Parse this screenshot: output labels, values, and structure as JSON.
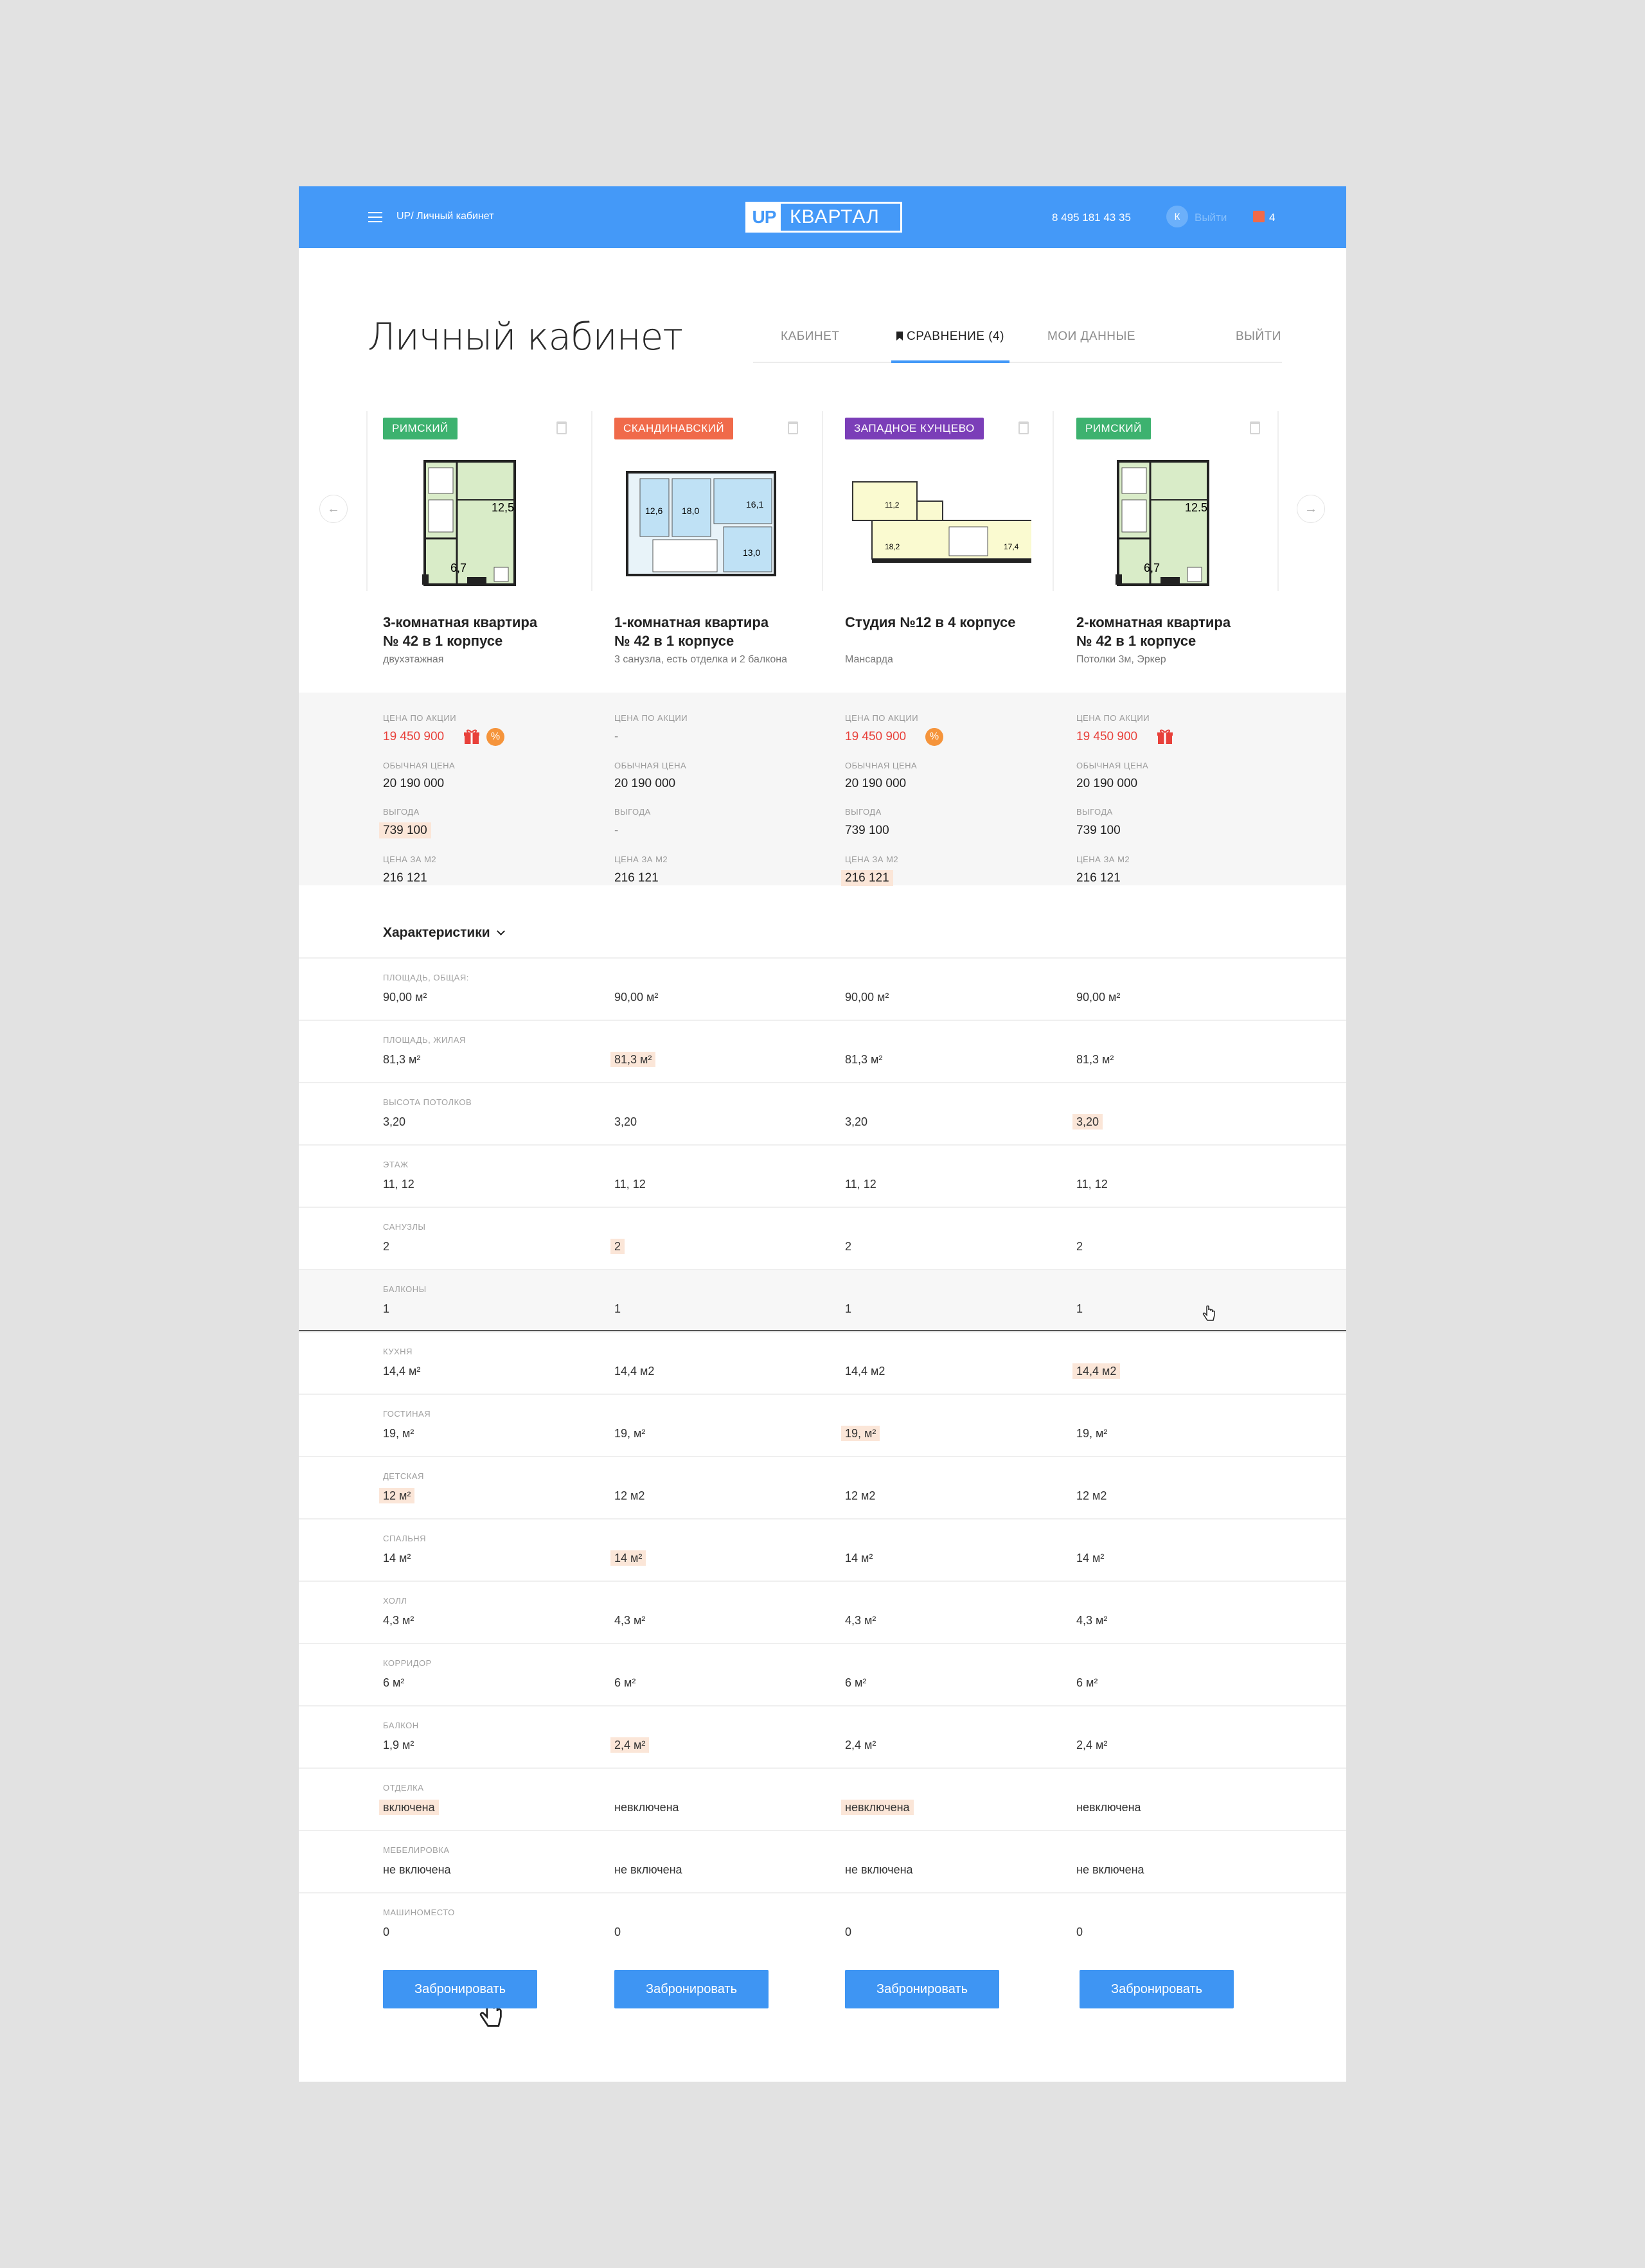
{
  "header": {
    "breadcrumb": "UP/ Личный кабинет",
    "logo_up": "UP",
    "logo_name": "КВАРТАЛ",
    "phone": "8 495 181 43 35",
    "avatar_letter": "К",
    "logout_link": "Выйти",
    "compare_count": "4",
    "bg_color": "#4499f8"
  },
  "page": {
    "title": "Личный кабинет",
    "tabs": [
      "КАБИНЕТ",
      "СРАВНЕНИЕ (4)",
      "МОИ ДАННЫЕ",
      "ВЫЙТИ"
    ],
    "active_tab": "СРАВНЕНИЕ (4)"
  },
  "carousel": {
    "prev_icon": "arrow-left-icon",
    "next_icon": "arrow-right-icon"
  },
  "products": [
    {
      "badge": "РИМСКИЙ",
      "badge_color": "#3db26f",
      "title1": "3-комнатная квартира",
      "title2": "№ 42 в 1 корпусе",
      "subtitle": "двухэтажная",
      "promo_price": "19 450 900",
      "regular_price": "20 190 000",
      "benefit": "739 100",
      "price_m2": "216 121",
      "icons": [
        "gift-icon",
        "sale-icon"
      ]
    },
    {
      "badge": "СКАНДИНАВСКИЙ",
      "badge_color": "#f06a4a",
      "title1": "1-комнатная квартира",
      "title2": "№ 42 в 1 корпусе",
      "subtitle": "3 санузла, есть отделка и 2 балкона",
      "promo_price": "-",
      "regular_price": "20 190 000",
      "benefit": "-",
      "price_m2": "216 121",
      "icons": []
    },
    {
      "badge": "ЗАПАДНОЕ КУНЦЕВО",
      "badge_color": "#7b3eb8",
      "title1": "Студия №12 в 4 корпусе",
      "title2": "",
      "subtitle": "Мансарда",
      "promo_price": "19 450 900",
      "regular_price": "20 190 000",
      "benefit": "739 100",
      "price_m2": "216 121",
      "icons": [
        "sale-icon"
      ]
    },
    {
      "badge": "РИМСКИЙ",
      "badge_color": "#3db26f",
      "title1": "2-комнатная квартира",
      "title2": "№ 42 в 1 корпусе",
      "subtitle": "Потолки 3м, Эркер",
      "promo_price": "19 450 900",
      "regular_price": "20 190 000",
      "benefit": "739 100",
      "price_m2": "216 121",
      "icons": [
        "gift-icon"
      ]
    }
  ],
  "price_labels": {
    "promo": "ЦЕНА ПО АКЦИИ",
    "regular": "ОБЫЧНАЯ ЦЕНА",
    "benefit": "ВЫГОДА",
    "per_m2": "ЦЕНА ЗА М2"
  },
  "characteristics": {
    "title": "Характеристики",
    "rows": [
      {
        "label": "ПЛОЩАДЬ, ОБЩАЯ:",
        "values": [
          "90,00 м²",
          "90,00 м²",
          "90,00 м²",
          "90,00 м²"
        ],
        "highlight": -1
      },
      {
        "label": "ПЛОЩАДЬ, ЖИЛАЯ",
        "values": [
          "81,3 м²",
          "81,3 м²",
          "81,3 м²",
          "81,3 м²"
        ],
        "highlight": 1
      },
      {
        "label": "ВЫСОТА ПОТОЛКОВ",
        "values": [
          "3,20",
          "3,20",
          "3,20",
          "3,20"
        ],
        "highlight": 3
      },
      {
        "label": "ЭТАЖ",
        "values": [
          "11, 12",
          "11, 12",
          "11, 12",
          "11, 12"
        ],
        "highlight": -1
      },
      {
        "label": "САНУЗЛЫ",
        "values": [
          "2",
          "2",
          "2",
          "2"
        ],
        "highlight": 1
      },
      {
        "label": "БАЛКОНЫ",
        "values": [
          "1",
          "1",
          "1",
          "1"
        ],
        "highlight": -1
      },
      {
        "label": "КУХНЯ",
        "values": [
          "14,4 м²",
          "14,4 м2",
          "14,4 м2",
          "14,4 м2"
        ],
        "highlight": 3
      },
      {
        "label": "ГОСТИНАЯ",
        "values": [
          "19, м²",
          "19, м²",
          "19, м²",
          "19, м²"
        ],
        "highlight": 2
      },
      {
        "label": "ДЕТСКАЯ",
        "values": [
          "12 м²",
          "12 м2",
          "12 м2",
          "12 м2"
        ],
        "highlight": 0
      },
      {
        "label": "СПАЛЬНЯ",
        "values": [
          "14 м²",
          "14 м²",
          "14 м²",
          "14 м²"
        ],
        "highlight": 1
      },
      {
        "label": "ХОЛЛ",
        "values": [
          "4,3 м²",
          "4,3 м²",
          "4,3 м²",
          "4,3 м²"
        ],
        "highlight": -1
      },
      {
        "label": "КОРРИДОР",
        "values": [
          "6 м²",
          "6 м²",
          "6 м²",
          "6 м²"
        ],
        "highlight": -1
      },
      {
        "label": "БАЛКОН",
        "values": [
          "1,9 м²",
          "2,4 м²",
          "2,4 м²",
          "2,4 м²"
        ],
        "highlight": 1
      },
      {
        "label": "ОТДЕЛКА",
        "values": [
          "включена",
          "невключена",
          "невключена",
          "невключена"
        ],
        "highlight2": [
          0,
          2
        ]
      },
      {
        "label": "МЕБЕЛИРОВКА",
        "values": [
          "не включена",
          "не включена",
          "не включена",
          "не включена"
        ],
        "highlight": -1
      },
      {
        "label": "МАШИНОМЕСТО",
        "values": [
          "0",
          "0",
          "0",
          "0"
        ],
        "highlight": -1
      }
    ]
  },
  "book_label": "Забронировать",
  "colors": {
    "accent": "#4499f8",
    "highlight": "#fbe6d8",
    "promo_red": "#e8413b"
  }
}
